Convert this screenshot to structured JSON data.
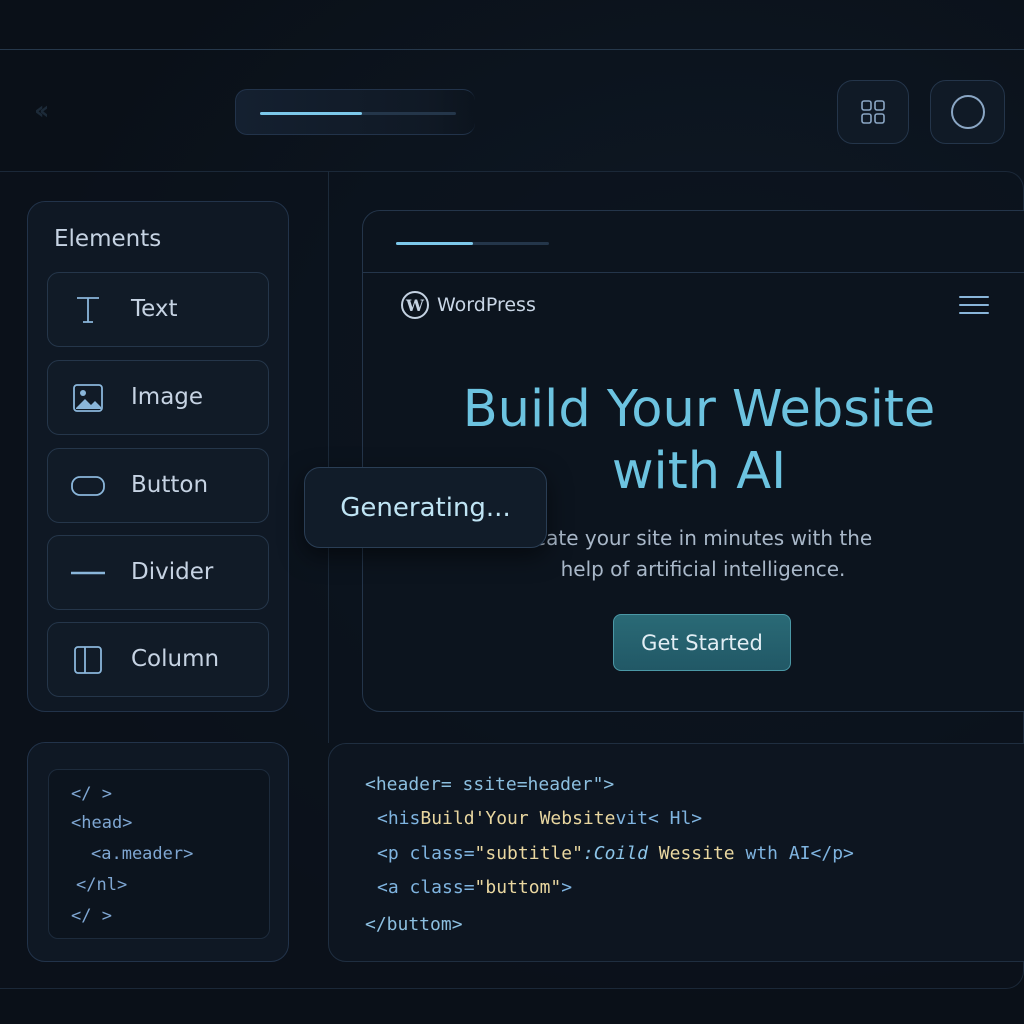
{
  "toolbar": {
    "back_forward_icon": "double-chevron-icon",
    "progress": 0.52,
    "grid_button_icon": "grid-icon",
    "circle_button_icon": "circle-icon"
  },
  "elements_panel": {
    "title": "Elements",
    "items": [
      {
        "label": "Text",
        "icon": "text-icon"
      },
      {
        "label": "Image",
        "icon": "image-icon"
      },
      {
        "label": "Button",
        "icon": "button-icon"
      },
      {
        "label": "Divider",
        "icon": "divider-icon"
      },
      {
        "label": "Column",
        "icon": "column-icon"
      }
    ]
  },
  "code_left": {
    "lines": [
      "</ >",
      "<head>",
      "<a.meader>",
      "</nl>",
      "</ >"
    ]
  },
  "preview": {
    "progress": 0.5,
    "brand": "WordPress",
    "brand_mark": "W",
    "hero_title_line1": "Build Your Website",
    "hero_title_line2": "with AI",
    "hero_sub_line1": "eate your site in minutes with the",
    "hero_sub_line2": "help of artificial intelligence.",
    "cta_label": "Get Started"
  },
  "overlay": {
    "generating_label": "Generating..."
  },
  "code_right": {
    "line1": "<header= ssite=header\">",
    "line2_a": "<his",
    "line2_b": "Build'Your Website",
    "line2_c": "vit< Hl>",
    "line3_a": "<p class=",
    "line3_b": "\"subtitle\"",
    "line3_c": ":Coild",
    "line3_d": " Wessite",
    "line3_e": " wth AI</p>",
    "line4_a": "<a class=",
    "line4_b": "\"buttom\"",
    "line4_c": ">",
    "line5": "</buttom>"
  },
  "colors": {
    "accent": "#7cc8ea",
    "hero_text": "#6cc3e0",
    "cta_bg": "#2a6a76",
    "background": "#0b1119"
  }
}
